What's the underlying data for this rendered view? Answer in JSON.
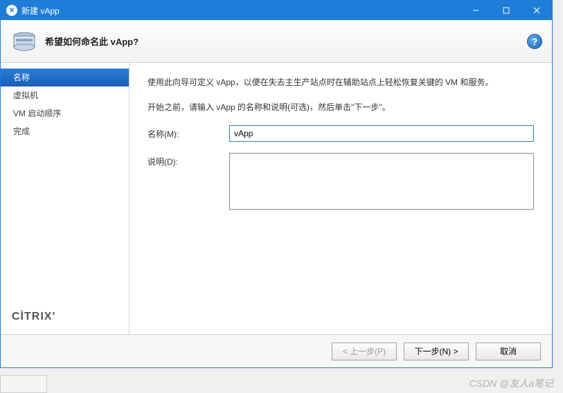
{
  "window": {
    "title": "新建 vApp"
  },
  "header": {
    "title": "希望如何命名此 vApp?"
  },
  "sidebar": {
    "items": [
      {
        "label": "名称",
        "selected": true
      },
      {
        "label": "虚拟机",
        "selected": false
      },
      {
        "label": "VM 启动顺序",
        "selected": false
      },
      {
        "label": "完成",
        "selected": false
      }
    ],
    "logo": "CİTRIX"
  },
  "main": {
    "intro": "使用此向导可定义 vApp，以便在失去主生产站点时在辅助站点上轻松恢复关键的 VM 和服务。",
    "instruction": "开始之前，请输入 vApp 的名称和说明(可选)，然后单击\"下一步\"。",
    "name_label": "名称(M):",
    "name_value": "vApp",
    "desc_label": "说明(D):",
    "desc_value": ""
  },
  "buttons": {
    "prev": "< 上一步(P)",
    "next": "下一步(N) >",
    "cancel": "取消"
  },
  "watermark": "CSDN @友人a笔记"
}
